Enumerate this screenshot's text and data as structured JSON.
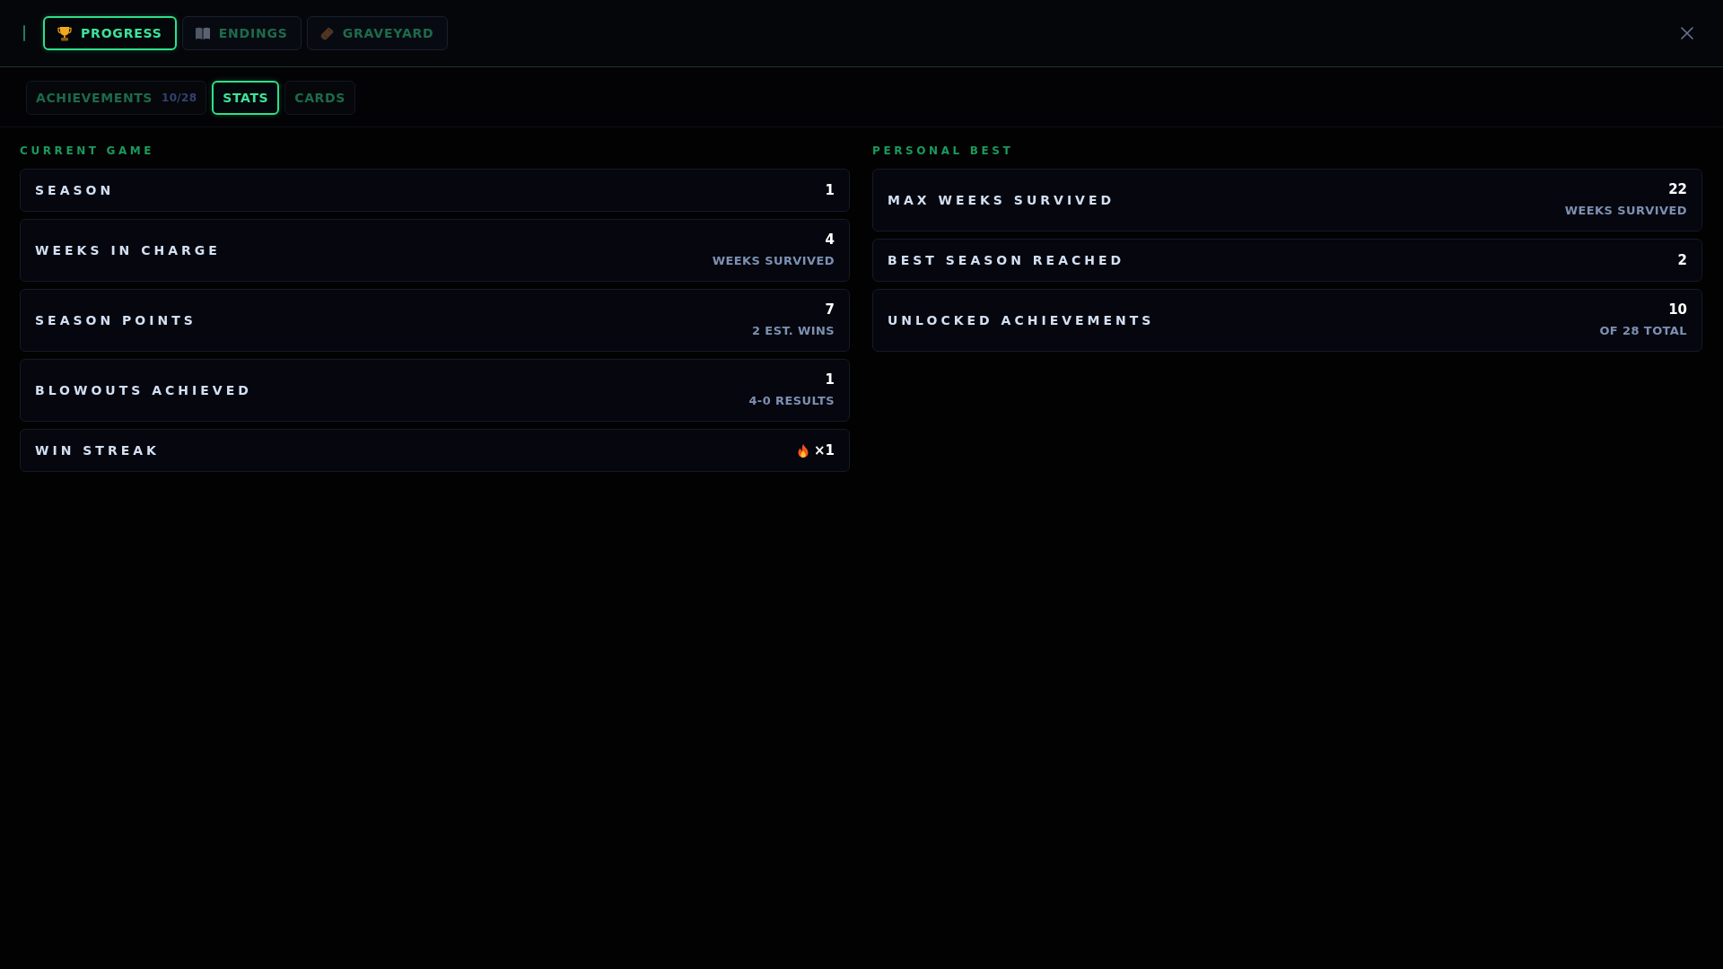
{
  "main_tabs": [
    {
      "label": "PROGRESS",
      "selected": true
    },
    {
      "label": "ENDINGS",
      "selected": false
    },
    {
      "label": "GRAVEYARD",
      "selected": false
    }
  ],
  "sub_tabs": [
    {
      "label": "ACHIEVEMENTS",
      "count": "10/28",
      "selected": false
    },
    {
      "label": "STATS",
      "selected": true
    },
    {
      "label": "CARDS",
      "selected": false
    }
  ],
  "current_game": {
    "heading": "CURRENT GAME",
    "stats": [
      {
        "kind": "number",
        "label": "SEASON",
        "value": "1"
      },
      {
        "kind": "number",
        "label": "WEEKS IN CHARGE",
        "value": "4",
        "note": "WEEKS SURVIVED"
      },
      {
        "kind": "number",
        "label": "SEASON POINTS",
        "value": "7",
        "note": "2 EST. WINS"
      },
      {
        "kind": "number",
        "label": "BLOWOUTS ACHIEVED",
        "value": "1",
        "note": "4-0 RESULTS"
      },
      {
        "kind": "streak",
        "label": "WIN STREAK",
        "value": "×1"
      }
    ]
  },
  "personal_best": {
    "heading": "PERSONAL BEST",
    "stats": [
      {
        "kind": "number",
        "label": "MAX WEEKS SURVIVED",
        "value": "22",
        "note": "WEEKS SURVIVED"
      },
      {
        "kind": "number",
        "label": "BEST SEASON REACHED",
        "value": "2"
      },
      {
        "kind": "number",
        "label": "UNLOCKED ACHIEVEMENTS",
        "value": "10",
        "note": "OF 28 TOTAL"
      }
    ]
  }
}
